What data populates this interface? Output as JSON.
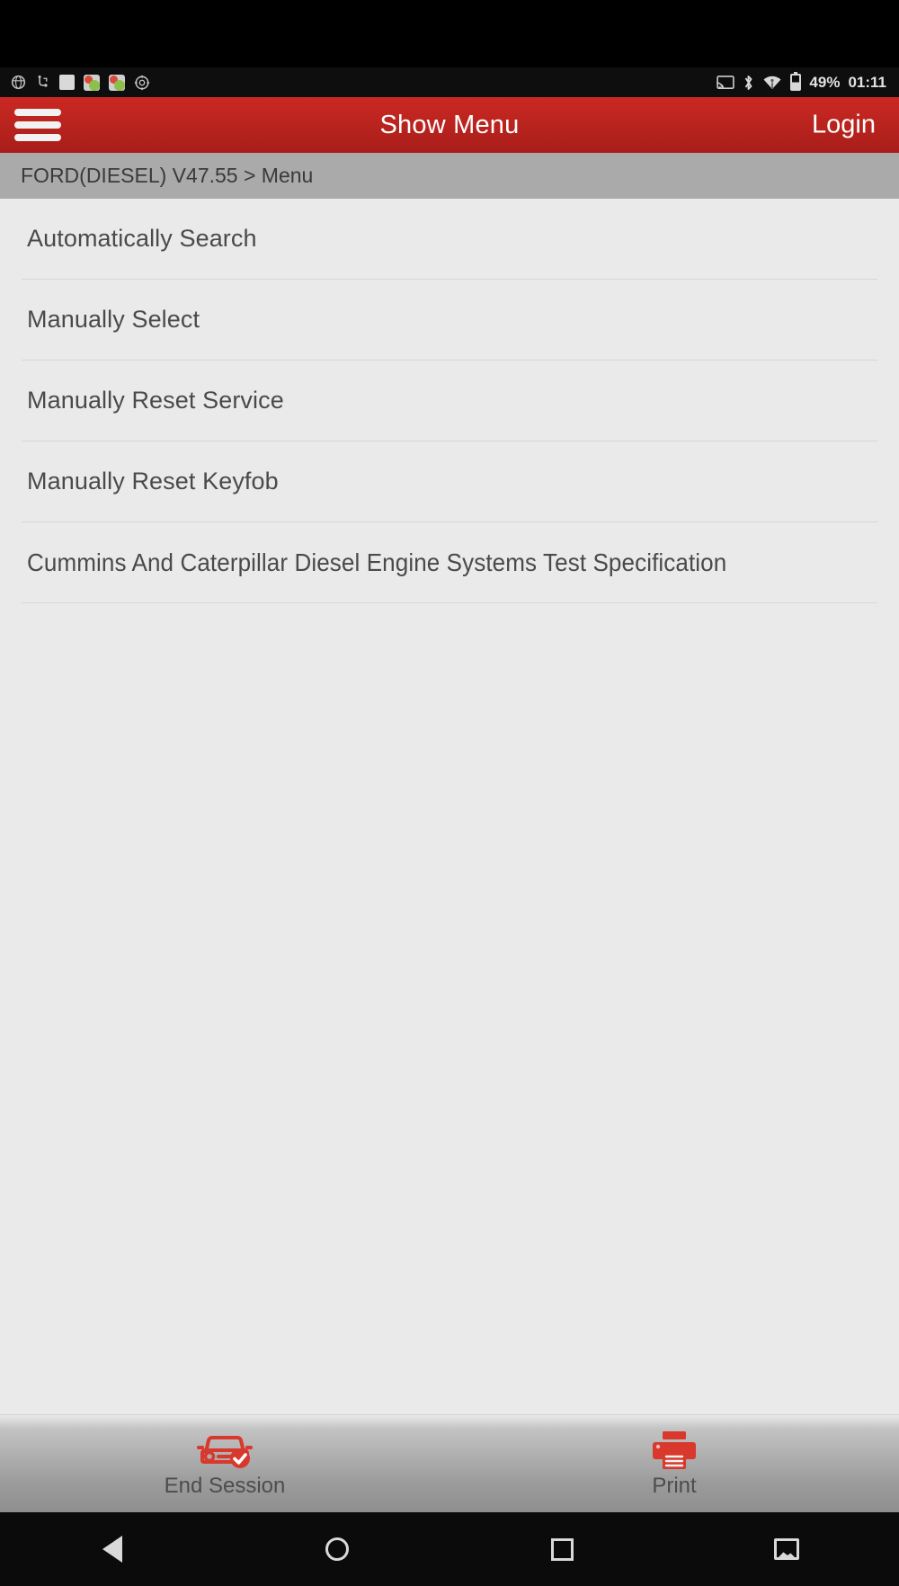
{
  "statusbar": {
    "left_icons": [
      "browser-icon",
      "usb-debug-icon",
      "blank-notification-icon",
      "app-notification-icon-1",
      "app-notification-icon-2",
      "settings-gear-icon"
    ],
    "right_icons": [
      "cast-icon",
      "bluetooth-icon",
      "wifi-icon",
      "battery-icon"
    ],
    "battery_percent": "49%",
    "clock": "01:11"
  },
  "appbar": {
    "menu_icon": "hamburger-menu-icon",
    "title": "Show Menu",
    "action_label": "Login",
    "background_color": "#b8231e"
  },
  "breadcrumb": {
    "text": "FORD(DIESEL) V47.55 > Menu",
    "background_color": "#aaaaaa"
  },
  "menu": {
    "items": [
      {
        "label": "Automatically Search"
      },
      {
        "label": "Manually Select"
      },
      {
        "label": "Manually Reset Service"
      },
      {
        "label": "Manually Reset Keyfob"
      },
      {
        "label": "Cummins And Caterpillar Diesel Engine Systems Test Specification"
      }
    ]
  },
  "toolbar": {
    "end_session_label": "End Session",
    "end_session_icon": "car-check-icon",
    "print_label": "Print",
    "print_icon": "printer-icon",
    "icon_color": "#d9382c"
  },
  "navbar": {
    "back_icon": "back-triangle-icon",
    "home_icon": "home-circle-icon",
    "recents_icon": "recents-square-icon",
    "screenshot_icon": "screenshot-icon"
  }
}
